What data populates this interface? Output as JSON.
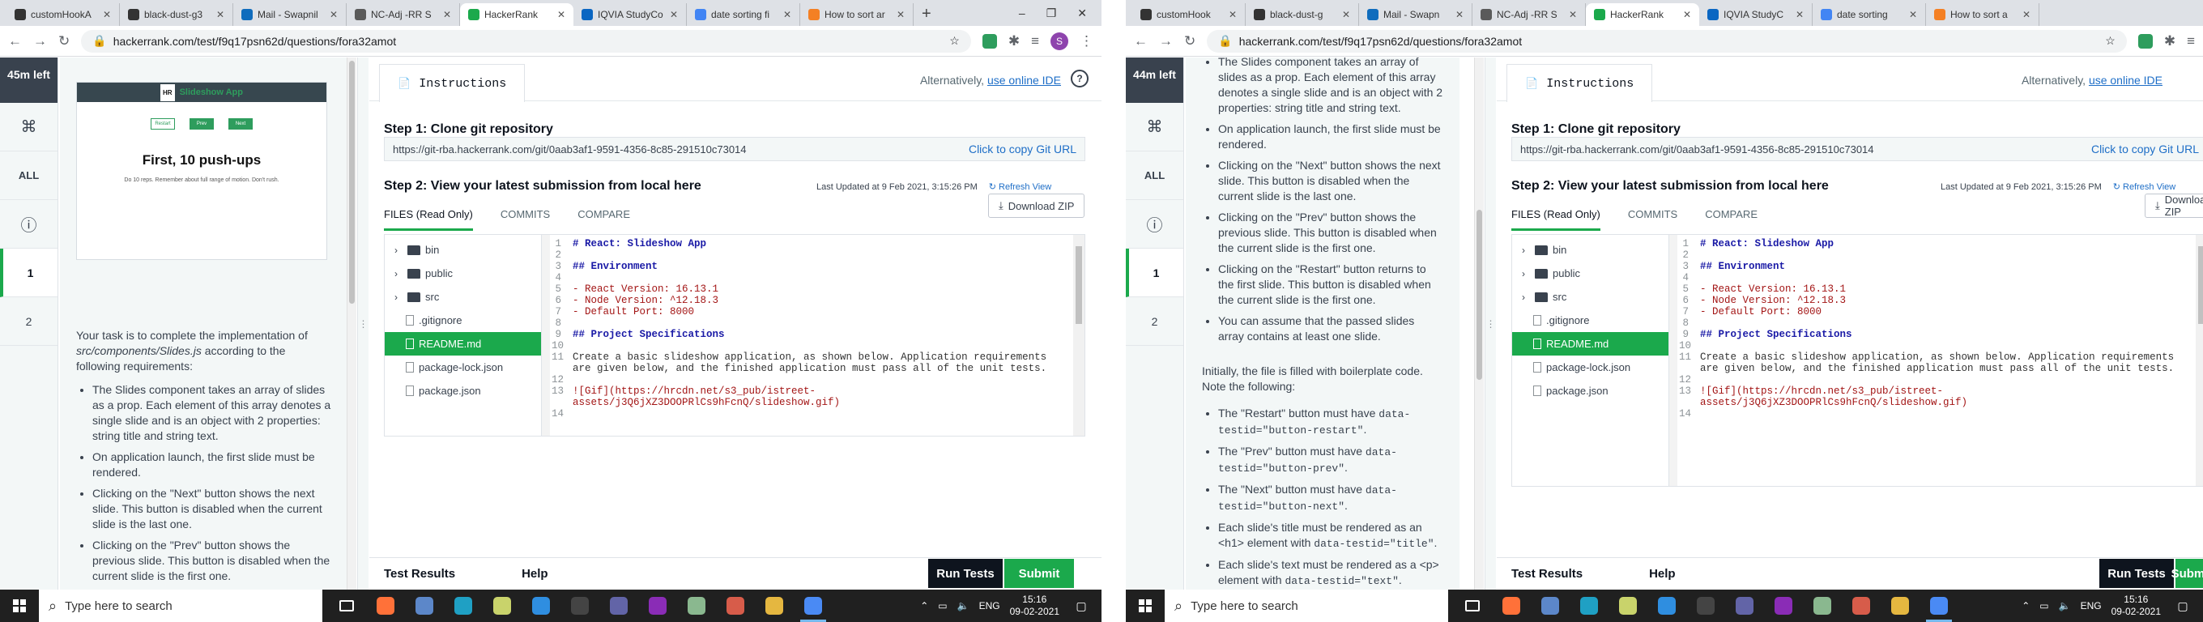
{
  "left_screen": {
    "browser": {
      "tabs": [
        {
          "label": "customHookA",
          "color": "#333333"
        },
        {
          "label": "black-dust-g3",
          "color": "#333333"
        },
        {
          "label": "Mail - Swapnil",
          "color": "#0f6cbd"
        },
        {
          "label": "NC-Adj -RR S",
          "color": "#5a5a5a"
        },
        {
          "label": "HackerRank",
          "color": "#1ba94c"
        },
        {
          "label": "IQVIA StudyCo",
          "color": "#0a66c2"
        },
        {
          "label": "date sorting fi",
          "color": "#4285f4"
        },
        {
          "label": "How to sort ar",
          "color": "#f48024"
        }
      ],
      "active_tab": 4,
      "url": "hackerrank.com/test/f9q17psn62d/questions/fora32amot"
    },
    "rail": {
      "timer": "45m left",
      "cmd_glyph": "⌘",
      "all_label": "ALL",
      "info_glyph": "ⓘ",
      "questions": [
        "1",
        "2"
      ]
    },
    "preview": {
      "header": "Slideshow App",
      "logo": "HR",
      "buttons": [
        "Restart",
        "Prev",
        "Next"
      ],
      "slide_title": "First, 10 push-ups",
      "slide_text": "Do 10 reps. Remember about full range of motion. Don't rush."
    },
    "question": {
      "intro_pre": "Your task is to complete the implementation of ",
      "intro_file": "src/components/Slides.js",
      "intro_post": " according to the following requirements:",
      "bullets": [
        "The Slides component takes an array of slides as a prop. Each element of this array denotes a single slide and is an object with 2 properties: string title and string text.",
        "On application launch, the first slide must be rendered.",
        "Clicking on the \"Next\" button shows the next slide. This button is disabled when the current slide is the last one.",
        "Clicking on the \"Prev\" button shows the previous slide. This button is disabled when the current slide is the first one.",
        "Clicking on the \"Restart\" button returns to"
      ]
    }
  },
  "right_screen": {
    "browser": {
      "tabs": [
        {
          "label": "customHook",
          "color": "#333333"
        },
        {
          "label": "black-dust-g",
          "color": "#333333"
        },
        {
          "label": "Mail - Swapn",
          "color": "#0f6cbd"
        },
        {
          "label": "NC-Adj -RR S",
          "color": "#5a5a5a"
        },
        {
          "label": "HackerRank",
          "color": "#1ba94c"
        },
        {
          "label": "IQVIA StudyC",
          "color": "#0a66c2"
        },
        {
          "label": "date sorting",
          "color": "#4285f4"
        },
        {
          "label": "How to sort a",
          "color": "#f48024"
        }
      ],
      "active_tab": 4,
      "url": "hackerrank.com/test/f9q17psn62d/questions/fora32amot"
    },
    "rail": {
      "timer": "44m left",
      "cmd_glyph": "⌘",
      "all_label": "ALL",
      "info_glyph": "ⓘ",
      "questions": [
        "1",
        "2"
      ]
    },
    "question": {
      "bullets_top": [
        "The Slides component takes an array of slides as a prop. Each element of this array denotes a single slide and is an object with 2 properties: string title and string text.",
        "On application launch, the first slide must be rendered.",
        "Clicking on the \"Next\" button shows the next slide. This button is disabled when the current slide is the last one.",
        "Clicking on the \"Prev\" button shows the previous slide. This button is disabled when the current slide is the first one.",
        "Clicking on the \"Restart\" button returns to the first slide. This button is disabled when the current slide is the first one.",
        "You can assume that the passed slides array contains at least one slide."
      ],
      "boilerplate_note": "Initially, the file is filled with boilerplate code. Note the following:",
      "notes": [
        {
          "pre": "The \"Restart\" button must have ",
          "code": "data-testid=\"button-restart\"",
          "post": "."
        },
        {
          "pre": "The \"Prev\" button must have ",
          "code": "data-testid=\"button-prev\"",
          "post": "."
        },
        {
          "pre": "The \"Next\" button must have ",
          "code": "data-testid=\"button-next\"",
          "post": "."
        },
        {
          "pre": "Each slide's title must be rendered as an <h1> element with ",
          "code": "data-testid=\"title\"",
          "post": "."
        },
        {
          "pre": "Each slide's text must be rendered as a <p> element with ",
          "code": "data-testid=\"text\"",
          "post": "."
        }
      ]
    }
  },
  "workspace": {
    "instructions_tab": "Instructions",
    "alternatively": "Alternatively,",
    "online_ide": "use online IDE",
    "step1": "Step 1: Clone git repository",
    "git_url": "https://git-rba.hackerrank.com/git/0aab3af1-9591-4356-8c85-291510c73014",
    "copy_label": "Click to copy Git URL",
    "step2": "Step 2: View your latest submission from local here",
    "last_updated": "Last Updated at 9 Feb 2021, 3:15:26 PM",
    "refresh": "Refresh View",
    "subtabs": [
      "FILES (Read Only)",
      "COMMITS",
      "COMPARE"
    ],
    "download_zip": "Download ZIP",
    "tree": [
      {
        "name": "bin",
        "type": "folder"
      },
      {
        "name": "public",
        "type": "folder"
      },
      {
        "name": "src",
        "type": "folder"
      },
      {
        "name": ".gitignore",
        "type": "file"
      },
      {
        "name": "README.md",
        "type": "file",
        "active": true
      },
      {
        "name": "package-lock.json",
        "type": "file"
      },
      {
        "name": "package.json",
        "type": "file"
      }
    ],
    "code_lines": [
      {
        "n": "1",
        "t": "# React: Slideshow App",
        "k": "h"
      },
      {
        "n": "2",
        "t": "",
        "k": ""
      },
      {
        "n": "3",
        "t": "## Environment",
        "k": "h"
      },
      {
        "n": "4",
        "t": "",
        "k": ""
      },
      {
        "n": "5",
        "t": "- React Version: 16.13.1",
        "k": "l"
      },
      {
        "n": "6",
        "t": "- Node Version: ^12.18.3",
        "k": "l"
      },
      {
        "n": "7",
        "t": "- Default Port: 8000",
        "k": "l"
      },
      {
        "n": "8",
        "t": "",
        "k": ""
      },
      {
        "n": "9",
        "t": "## Project Specifications",
        "k": "h"
      },
      {
        "n": "10",
        "t": "",
        "k": ""
      },
      {
        "n": "11",
        "t": "Create a basic slideshow application, as shown below. Application requirements are given below, and the finished application must pass all of the unit tests.",
        "k": ""
      },
      {
        "n": "12",
        "t": "",
        "k": ""
      },
      {
        "n": "13",
        "t": "![Gif](https://hrcdn.net/s3_pub/istreet-assets/j3Q6jXZ3DOOPRlCs9hFcnQ/slideshow.gif)",
        "k": "lk"
      },
      {
        "n": "14",
        "t": "",
        "k": ""
      }
    ],
    "test_results": "Test Results",
    "help": "Help",
    "run_tests": "Run Tests",
    "submit": "Submit"
  },
  "taskbar": {
    "search_placeholder": "Type here to search",
    "lang": "ENG",
    "left_time": "15:16",
    "left_date": "09-02-2021",
    "right_time": "15:16",
    "right_date": "09-02-2021",
    "apps": [
      {
        "name": "task-view-icon",
        "color": "#ffffff"
      },
      {
        "name": "firefox-icon",
        "color": "#ff7139"
      },
      {
        "name": "app-icon",
        "color": "#5c87c9"
      },
      {
        "name": "edge-icon",
        "color": "#1fa0c4"
      },
      {
        "name": "notepad-icon",
        "color": "#c9d36b"
      },
      {
        "name": "vscode-icon",
        "color": "#2f8ee0"
      },
      {
        "name": "terminal-icon",
        "color": "#444444"
      },
      {
        "name": "teams-icon",
        "color": "#6264a7"
      },
      {
        "name": "onenote-icon",
        "color": "#8a2cb6"
      },
      {
        "name": "tool-icon",
        "color": "#8ab88f"
      },
      {
        "name": "postman-icon",
        "color": "#d75c4a"
      },
      {
        "name": "explorer-icon",
        "color": "#e5b740"
      },
      {
        "name": "chrome-icon",
        "color": "#4a8af4"
      }
    ]
  }
}
